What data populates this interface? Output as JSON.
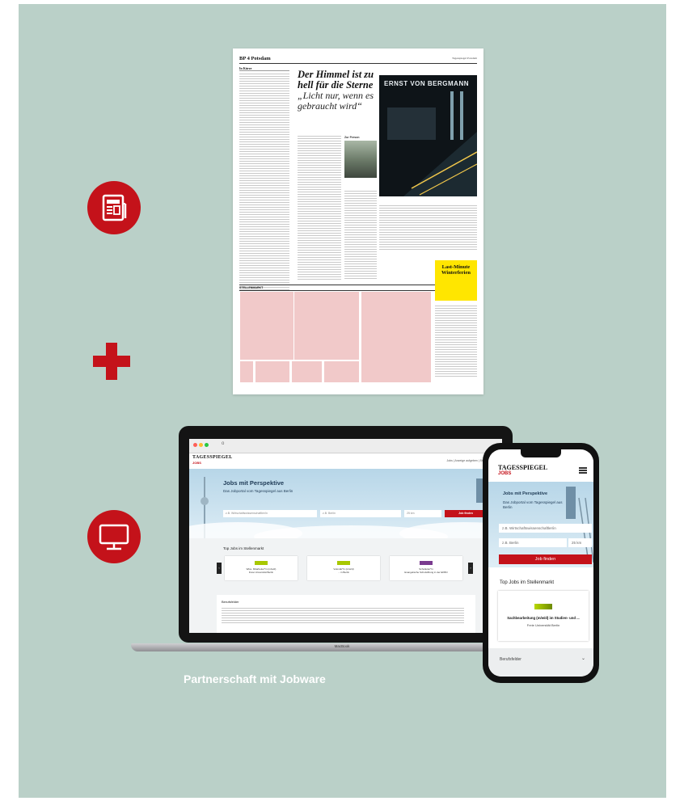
{
  "colors": {
    "background": "#bad0c8",
    "accent": "#c4121a",
    "caption_text": "#ffffff"
  },
  "icons": {
    "newspaper": "newspaper-icon",
    "plus": "plus-icon",
    "monitor": "monitor-icon"
  },
  "newspaper": {
    "section": "BP 4  Potsdam",
    "header_right": "Tagesspiegel Potsdam",
    "left_heading": "In Kürze",
    "headline": "Der Himmel ist zu hell für die Sterne",
    "subheadline": "„Licht nur, wenn es gebraucht wird“",
    "photo_sign": "ERNST VON BERGMANN",
    "person_label": "Zur Person",
    "stellenmarkt": "STELLENMARKT",
    "ad_title": "Last-Minute Winterferien"
  },
  "laptop": {
    "brand": "MacBook",
    "url": "o",
    "logo": "TAGESSPIEGEL",
    "logo_sub": "JOBS",
    "nav_links": "Jobs  |  Anzeige aufgeben  |  Stellenmärkte",
    "hero_title": "Jobs mit Perspektive",
    "hero_sub": "Das Jobportal vom Tagesspiegel aus Berlin",
    "search_placeholder": "z.B. Wirtschaftswissenschaftler/in",
    "location_placeholder": "z.B. Berlin",
    "radius": "25 km",
    "search_button": "Job finden",
    "top_jobs": "Top Jobs im Stellenmarkt",
    "cards": [
      {
        "title": "Wiss. Mitarbeiter*in (m/w/d)",
        "sub": "Freie Universität Berlin",
        "logo_color": "#a8c800"
      },
      {
        "title": "Volontär*in (m/w/d)",
        "sub": "... in Berlin",
        "logo_color": "#a8c800"
      },
      {
        "title": "Schulleiter*in",
        "sub": "Evangelische Schulstiftung in der EKBO",
        "logo_color": "#7a3b8f"
      }
    ],
    "prev_arrow": "‹",
    "next_arrow": "›",
    "berufsfelder": "Berufsfelder"
  },
  "phone": {
    "logo": "TAGESSPIEGEL",
    "logo_sub": "JOBS",
    "hero_title": "Jobs mit Perspektive",
    "hero_sub": "Das Jobportal vom Tagesspiegel aus Berlin",
    "search_placeholder": "z.B. Wirtschaftswissenschaftler/in",
    "location_placeholder": "z.B. Berlin",
    "radius": "25 km",
    "search_button": "Job finden",
    "top_jobs": "Top Jobs im Stellenmarkt",
    "card_title": "Sachbearbeitung (m/w/d) im Studien- und ...",
    "card_sub": "Freie Universität Berlin",
    "berufsfelder": "Berufsfelder",
    "chevron": "⌄"
  },
  "caption": "Partnerschaft mit Jobware"
}
